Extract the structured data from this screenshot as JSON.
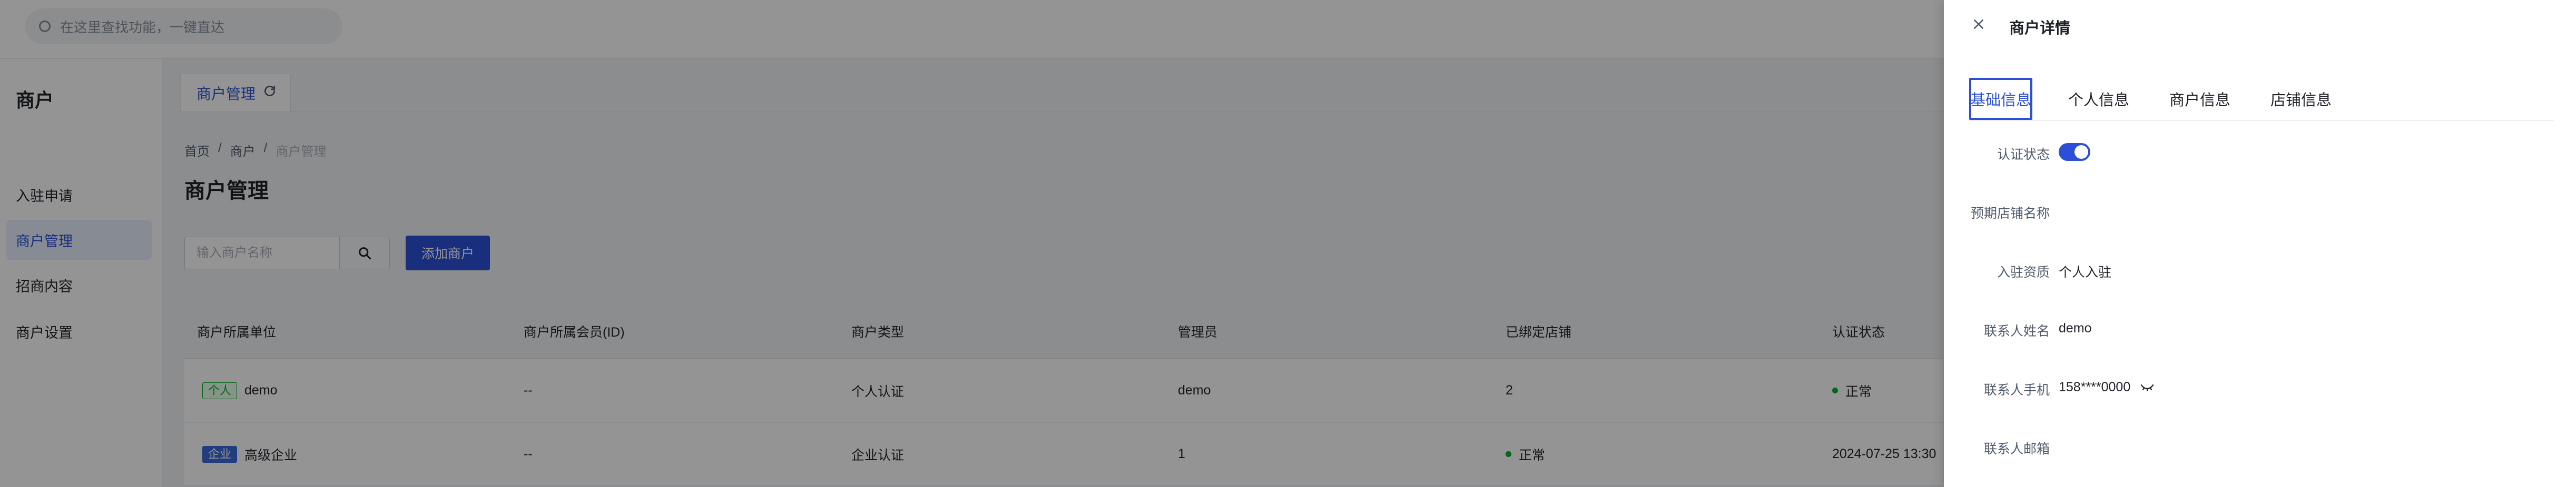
{
  "topbar": {
    "search_placeholder": "在这里查找功能，一键直达"
  },
  "sidebar": {
    "title": "商户",
    "items": [
      {
        "label": "入驻申请"
      },
      {
        "label": "商户管理"
      },
      {
        "label": "招商内容"
      },
      {
        "label": "商户设置"
      }
    ]
  },
  "content": {
    "tab_label": "商户管理",
    "breadcrumb": [
      "首页",
      "/",
      "商户",
      "/",
      "商户管理"
    ],
    "page_title": "商户管理",
    "filter_placeholder": "输入商户名称",
    "add_button": "添加商户",
    "table": {
      "columns": [
        "商户所属单位",
        "商户所属会员(ID)",
        "商户类型",
        "管理员",
        "已绑定店铺",
        "认证状态"
      ],
      "rows": [
        {
          "tag": "个人",
          "unit": "demo",
          "member": "--",
          "type": "个人认证",
          "admin": "demo",
          "shops": "2",
          "status": "正常"
        },
        {
          "tag": "企业",
          "unit": "高级企业",
          "member": "--",
          "type": "企业认证",
          "admin": "1",
          "shops": "正常",
          "status": "2024-07-25 13:30"
        }
      ]
    }
  },
  "drawer": {
    "title": "商户详情",
    "tabs": [
      "基础信息",
      "个人信息",
      "商户信息",
      "店铺信息"
    ],
    "fields": {
      "cert_status_label": "认证状态",
      "cert_status_on": true,
      "shop_name_label": "预期店铺名称",
      "qualification_label": "入驻资质",
      "qualification_value": "个人入驻",
      "contact_name_label": "联系人姓名",
      "contact_name_value": "demo",
      "contact_phone_label": "联系人手机",
      "contact_phone_value": "158****0000",
      "contact_email_label": "联系人邮箱"
    }
  },
  "colors": {
    "accent": "#2b50d7",
    "success": "#00b42a",
    "mask": "rgba(0,0,0,0.42)"
  }
}
